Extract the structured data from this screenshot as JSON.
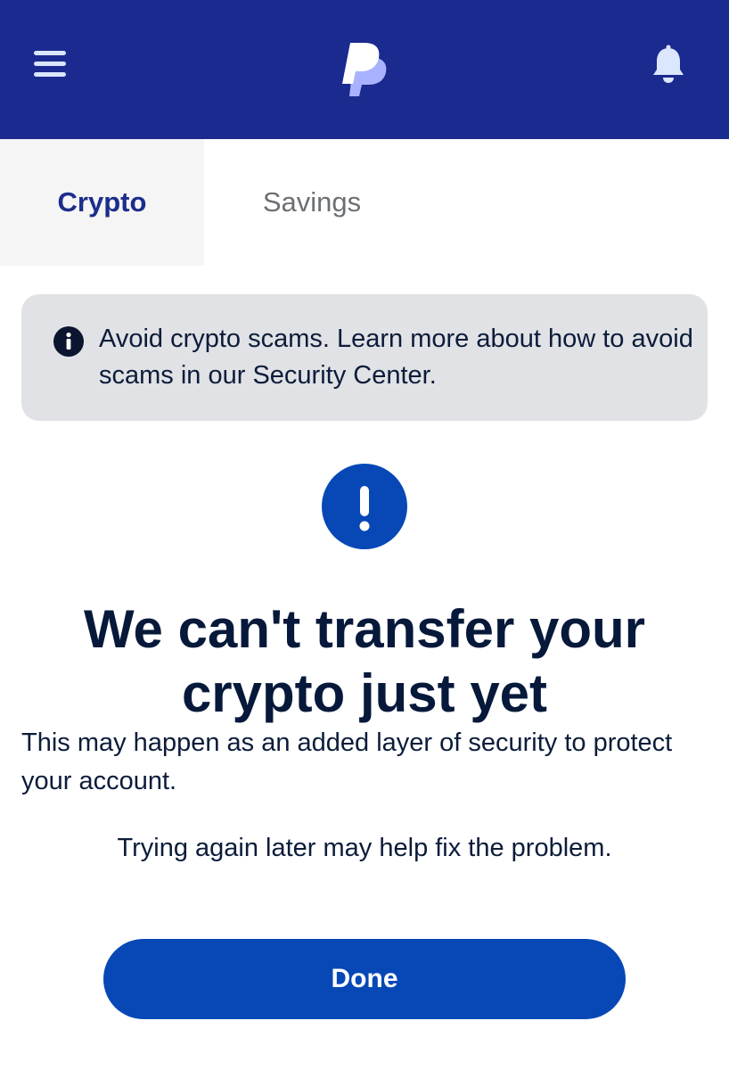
{
  "header": {
    "menu_icon": "hamburger-menu-icon",
    "logo": "paypal-logo",
    "notification_icon": "bell-icon",
    "background_color": "#1b2a8f"
  },
  "tabs": [
    {
      "label": "Crypto",
      "active": true
    },
    {
      "label": "Savings",
      "active": false
    }
  ],
  "banner": {
    "icon": "info-icon",
    "text": "Avoid crypto scams. Learn more about how to avoid scams in our Security Center."
  },
  "alert": {
    "icon": "exclamation-icon",
    "icon_color": "#0748b6"
  },
  "message": {
    "title": "We can't transfer your crypto just yet",
    "description": "This may happen as an added layer of security to protect your account.",
    "hint": "Trying again later may help fix the problem."
  },
  "actions": {
    "done_label": "Done",
    "button_color": "#0748b6"
  }
}
